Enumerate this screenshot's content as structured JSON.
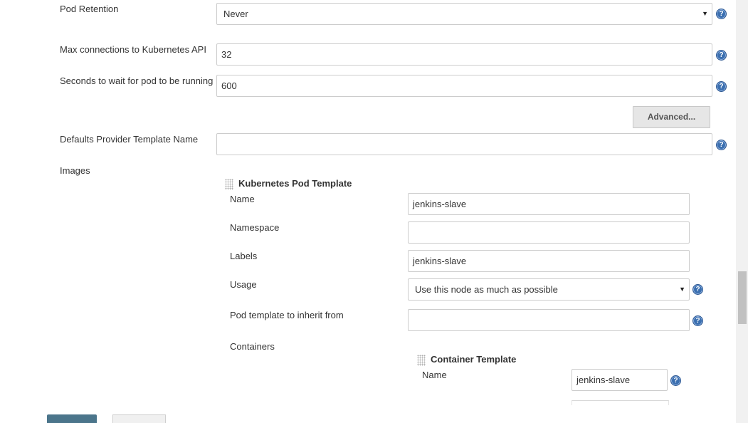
{
  "form": {
    "pod_retention": {
      "label": "Pod Retention",
      "value": "Never"
    },
    "max_connections": {
      "label": "Max connections to Kubernetes API",
      "value": "32"
    },
    "seconds_wait": {
      "label": "Seconds to wait for pod to be running",
      "value": "600"
    },
    "advanced_label": "Advanced...",
    "defaults_provider": {
      "label": "Defaults Provider Template Name",
      "value": ""
    },
    "images_label": "Images"
  },
  "pod_template": {
    "title": "Kubernetes Pod Template",
    "name": {
      "label": "Name",
      "value": "jenkins-slave"
    },
    "namespace": {
      "label": "Namespace",
      "value": ""
    },
    "labels": {
      "label": "Labels",
      "value": "jenkins-slave"
    },
    "usage": {
      "label": "Usage",
      "value": "Use this node as much as possible"
    },
    "inherit": {
      "label": "Pod template to inherit from",
      "value": ""
    },
    "containers_label": "Containers"
  },
  "container_template": {
    "title": "Container Template",
    "name": {
      "label": "Name",
      "value": "jenkins-slave"
    }
  },
  "help_glyph": "?",
  "dropdown_glyph": "▼",
  "colors": {
    "help_icon": "#3b6fb0",
    "save_button": "#4b758b"
  }
}
